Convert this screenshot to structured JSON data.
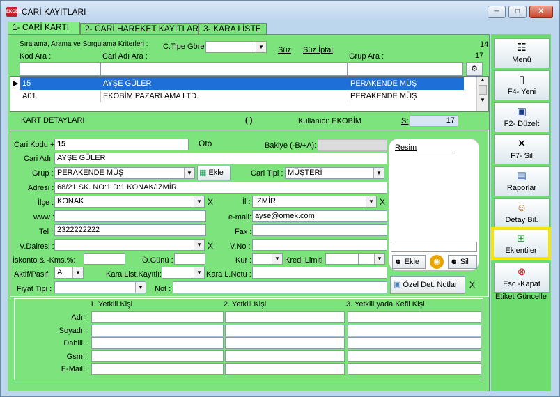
{
  "window": {
    "title": "CARİ KAYITLARI",
    "app_icon": "EKOBİM",
    "min": "─",
    "max": "□",
    "close": "✕"
  },
  "tabs": [
    "1- CARİ KARTI",
    "2- CARİ HAREKET KAYITLARI",
    "3- KARA LİSTE"
  ],
  "search": {
    "criteria_label": "Sıralama, Arama ve Sorgulama Kriterleri :",
    "ctype_label": "C.Tipe Göre:",
    "filter_label": "Süz",
    "filter_cancel_label": "Süz İptal",
    "count_top": "14",
    "count_bottom": "17",
    "code_label": "Kod Ara :",
    "name_label": "Cari Adı Ara :",
    "group_label": "Grup Ara :"
  },
  "list": {
    "rows": [
      {
        "code": "15",
        "name": "AYŞE GÜLER",
        "group": "PERAKENDE MÜŞ",
        "selected": true
      },
      {
        "code": "A01",
        "name": "EKOBİM PAZARLAMA LTD.",
        "group": "PERAKENDE MÜŞ",
        "selected": false
      }
    ]
  },
  "details_bar": {
    "title": "KART DETAYLARI",
    "spinner": "( )",
    "user_label": "Kullanıcı: EKOBİM",
    "s_label": "S:",
    "s_value": "17"
  },
  "form": {
    "code_label": "Cari Kodu +",
    "code_value": "15",
    "oto_label": "Oto",
    "balance_label": "Bakiye (-B/+A):",
    "balance_value": "",
    "name_label": "Cari Adı :",
    "name_value": "AYŞE GÜLER",
    "group_label": "Grup :",
    "group_value": "PERAKENDE MÜŞ",
    "add_label": "Ekle",
    "type_label": "Cari Tipi :",
    "type_value": "MÜŞTERİ",
    "address_label": "Adresi :",
    "address_value": "68/21 SK. NO:1 D:1 KONAK/İZMİR",
    "district_label": "İlçe :",
    "district_value": "KONAK",
    "city_label": "İl :",
    "city_value": "İZMİR",
    "www_label": "www :",
    "www_value": "",
    "email_label": "e-mail:",
    "email_value": "ayse@ornek.com",
    "tel_label": "Tel :",
    "tel_value": "2322222222",
    "fax_label": "Fax :",
    "fax_value": "",
    "taxoffice_label": "V.Dairesi :",
    "taxoffice_value": "",
    "taxno_label": "V.No :",
    "taxno_value": "",
    "discount_label": "İskonto & -Kms.%:",
    "pday_label": "Ö.Günü :",
    "rate_label": "Kur :",
    "credit_label": "Kredi Limiti :",
    "active_label": "Aktif/Pasif:",
    "active_value": "A",
    "blacklist_label": "Kara List.Kayıtlı:",
    "blacknote_label": "Kara L.Notu :",
    "price_label": "Fiyat Tipi :",
    "note_label": "Not :",
    "image_label": "Resim",
    "img_add": "Ekle",
    "img_del": "Sil",
    "special_notes": "Özel Det. Notlar",
    "x": "X"
  },
  "contacts": {
    "headers": [
      "1. Yetkili Kişi",
      "2. Yetkili Kişi",
      "3. Yetkili yada Kefil Kişi"
    ],
    "labels": [
      "Adı :",
      "Soyadı :",
      "Dahili :",
      "Gsm :",
      "E-Mail :"
    ]
  },
  "side_buttons": [
    {
      "label": "Menü",
      "icon": "menu-icon"
    },
    {
      "label": "F4- Yeni",
      "icon": "new-document-icon"
    },
    {
      "label": "F2- Düzelt",
      "icon": "save-icon"
    },
    {
      "label": "F7- Sil",
      "icon": "delete-icon"
    },
    {
      "label": "Raporlar",
      "icon": "report-icon"
    },
    {
      "label": "Detay Bil.",
      "icon": "detail-card-icon"
    },
    {
      "label": "Eklentiler",
      "icon": "attachment-add-icon",
      "highlighted": true
    },
    {
      "label": "Esc -Kapat",
      "icon": "close-circle-icon"
    }
  ],
  "side_footer": "Etiket Güncelle",
  "colors": {
    "green": "#7de37d",
    "selection": "#1e6fd8",
    "highlight": "#f4e800"
  }
}
